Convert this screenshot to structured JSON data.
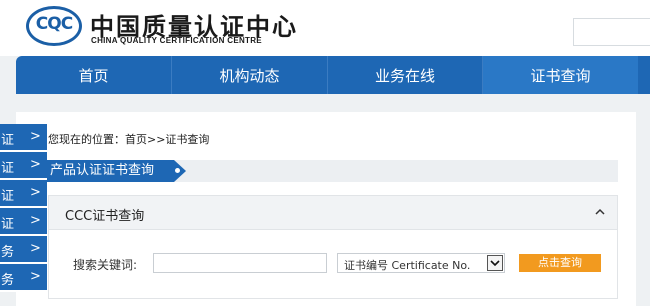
{
  "header": {
    "logo_text": "CQC",
    "brand_cn": "中国质量认证中心",
    "brand_en": "CHINA QUALITY CERTIFICATION CENTRE"
  },
  "nav": {
    "items": [
      {
        "label": "首页"
      },
      {
        "label": "机构动态"
      },
      {
        "label": "业务在线"
      },
      {
        "label": "证书查询"
      }
    ],
    "active_index": 3
  },
  "breadcrumb": "您现在的位置：首页>>证书查询",
  "section_title": "产品认证证书查询",
  "panel": {
    "title": "CCC证书查询",
    "toggle_icon": "chevron-up-icon",
    "search_label": "搜索关键词:",
    "search_value": "",
    "select_selected": "证书编号 Certificate No.",
    "query_button": "点击查询"
  },
  "sidebar": {
    "items": [
      {
        "label": "证"
      },
      {
        "label": "证"
      },
      {
        "label": "证"
      },
      {
        "label": "证"
      },
      {
        "label": "务"
      },
      {
        "label": "务"
      }
    ],
    "chevron": ">"
  },
  "colors": {
    "primary_blue": "#1e67b4",
    "button_orange": "#f29a1f",
    "page_gray": "#eef1f3"
  }
}
